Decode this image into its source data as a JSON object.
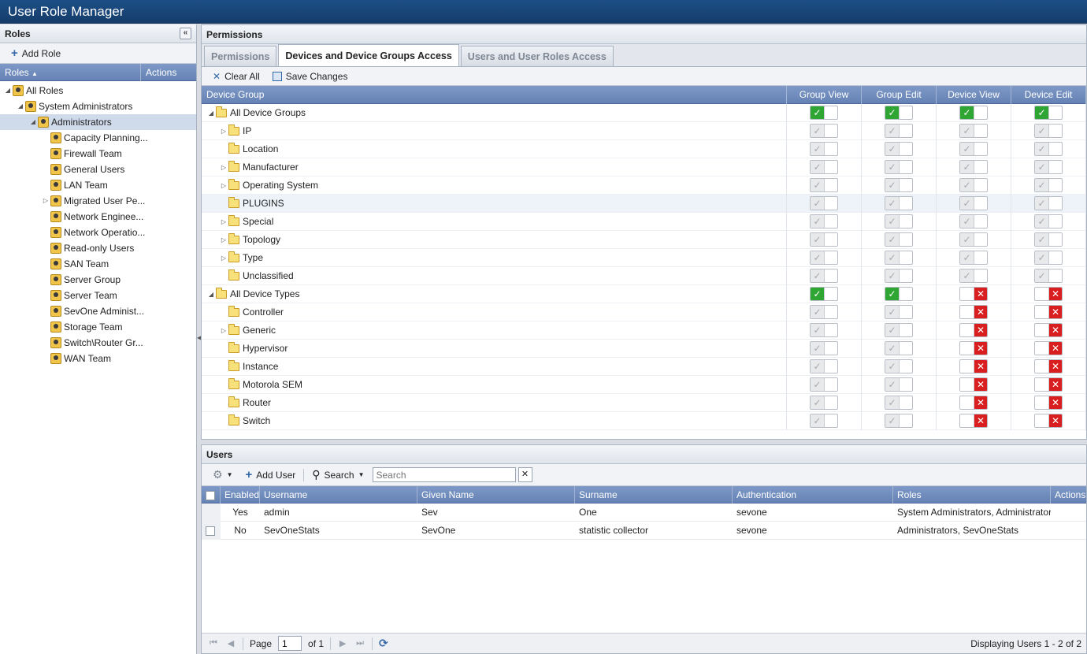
{
  "window_title": "User Role Manager",
  "roles_panel": {
    "title": "Roles",
    "add_role_label": "Add Role",
    "col_roles": "Roles",
    "col_actions": "Actions",
    "tree": [
      {
        "label": "All Roles",
        "level": 0,
        "arrow": "open"
      },
      {
        "label": "System Administrators",
        "level": 1,
        "arrow": "open"
      },
      {
        "label": "Administrators",
        "level": 2,
        "arrow": "open",
        "selected": true
      },
      {
        "label": "Capacity Planning...",
        "level": 3
      },
      {
        "label": "Firewall Team",
        "level": 3
      },
      {
        "label": "General Users",
        "level": 3
      },
      {
        "label": "LAN Team",
        "level": 3
      },
      {
        "label": "Migrated User Pe...",
        "level": 3,
        "arrow": "closed"
      },
      {
        "label": "Network Enginee...",
        "level": 3
      },
      {
        "label": "Network Operatio...",
        "level": 3
      },
      {
        "label": "Read-only Users",
        "level": 3
      },
      {
        "label": "SAN Team",
        "level": 3
      },
      {
        "label": "Server Group",
        "level": 3
      },
      {
        "label": "Server Team",
        "level": 3
      },
      {
        "label": "SevOne Administ...",
        "level": 3
      },
      {
        "label": "Storage Team",
        "level": 3
      },
      {
        "label": "Switch\\Router Gr...",
        "level": 3
      },
      {
        "label": "WAN Team",
        "level": 3
      }
    ]
  },
  "permissions_panel": {
    "title": "Permissions",
    "tabs": [
      {
        "label": "Permissions",
        "active": false
      },
      {
        "label": "Devices and Device Groups Access",
        "active": true
      },
      {
        "label": "Users and User Roles Access",
        "active": false
      }
    ],
    "clear_all_label": "Clear All",
    "save_changes_label": "Save Changes",
    "columns": [
      "Device Group",
      "Group View",
      "Group Edit",
      "Device View",
      "Device Edit"
    ],
    "rows": [
      {
        "label": "All Device Groups",
        "level": 0,
        "arrow": "open",
        "perms": [
          "on",
          "on",
          "on",
          "on"
        ]
      },
      {
        "label": "IP",
        "level": 1,
        "arrow": "closed",
        "perms": [
          "inh",
          "inh",
          "inh",
          "inh"
        ]
      },
      {
        "label": "Location",
        "level": 1,
        "perms": [
          "inh",
          "inh",
          "inh",
          "inh"
        ]
      },
      {
        "label": "Manufacturer",
        "level": 1,
        "arrow": "closed",
        "perms": [
          "inh",
          "inh",
          "inh",
          "inh"
        ]
      },
      {
        "label": "Operating System",
        "level": 1,
        "arrow": "closed",
        "perms": [
          "inh",
          "inh",
          "inh",
          "inh"
        ]
      },
      {
        "label": "PLUGINS",
        "level": 1,
        "highlight": true,
        "perms": [
          "inh",
          "inh",
          "inh",
          "inh"
        ]
      },
      {
        "label": "Special",
        "level": 1,
        "arrow": "closed",
        "perms": [
          "inh",
          "inh",
          "inh",
          "inh"
        ]
      },
      {
        "label": "Topology",
        "level": 1,
        "arrow": "closed",
        "perms": [
          "inh",
          "inh",
          "inh",
          "inh"
        ]
      },
      {
        "label": "Type",
        "level": 1,
        "arrow": "closed",
        "perms": [
          "inh",
          "inh",
          "inh",
          "inh"
        ]
      },
      {
        "label": "Unclassified",
        "level": 1,
        "perms": [
          "inh",
          "inh",
          "inh",
          "inh"
        ]
      },
      {
        "label": "All Device Types",
        "level": 0,
        "arrow": "open",
        "perms": [
          "on",
          "on",
          "off",
          "off"
        ]
      },
      {
        "label": "Controller",
        "level": 1,
        "perms": [
          "inh",
          "inh",
          "off",
          "off"
        ]
      },
      {
        "label": "Generic",
        "level": 1,
        "arrow": "closed",
        "perms": [
          "inh",
          "inh",
          "off",
          "off"
        ]
      },
      {
        "label": "Hypervisor",
        "level": 1,
        "perms": [
          "inh",
          "inh",
          "off",
          "off"
        ]
      },
      {
        "label": "Instance",
        "level": 1,
        "perms": [
          "inh",
          "inh",
          "off",
          "off"
        ]
      },
      {
        "label": "Motorola SEM",
        "level": 1,
        "perms": [
          "inh",
          "inh",
          "off",
          "off"
        ]
      },
      {
        "label": "Router",
        "level": 1,
        "perms": [
          "inh",
          "inh",
          "off",
          "off"
        ]
      },
      {
        "label": "Switch",
        "level": 1,
        "perms": [
          "inh",
          "inh",
          "off",
          "off"
        ]
      }
    ]
  },
  "users_panel": {
    "title": "Users",
    "add_user_label": "Add User",
    "search_label": "Search",
    "search_placeholder": "Search",
    "clear_glyph": "✕",
    "columns": [
      "Enabled",
      "Username",
      "Given Name",
      "Surname",
      "Authentication",
      "Roles",
      "Actions"
    ],
    "rows": [
      {
        "enabled": "Yes",
        "username": "admin",
        "given": "Sev",
        "surname": "One",
        "auth": "sevone",
        "roles": "System Administrators, Administrators",
        "checkbox": false
      },
      {
        "enabled": "No",
        "username": "SevOneStats",
        "given": "SevOne",
        "surname": "statistic collector",
        "auth": "sevone",
        "roles": "Administrators, SevOneStats",
        "checkbox": true
      }
    ],
    "pager": {
      "page_label": "Page",
      "page_value": "1",
      "of_label": "of 1",
      "display": "Displaying Users 1 - 2 of 2"
    }
  },
  "colors": {
    "header_blue": "#6582b5",
    "title_blue": "#1d4f87",
    "allow_green": "#2fa533",
    "deny_red": "#d81e1e"
  }
}
